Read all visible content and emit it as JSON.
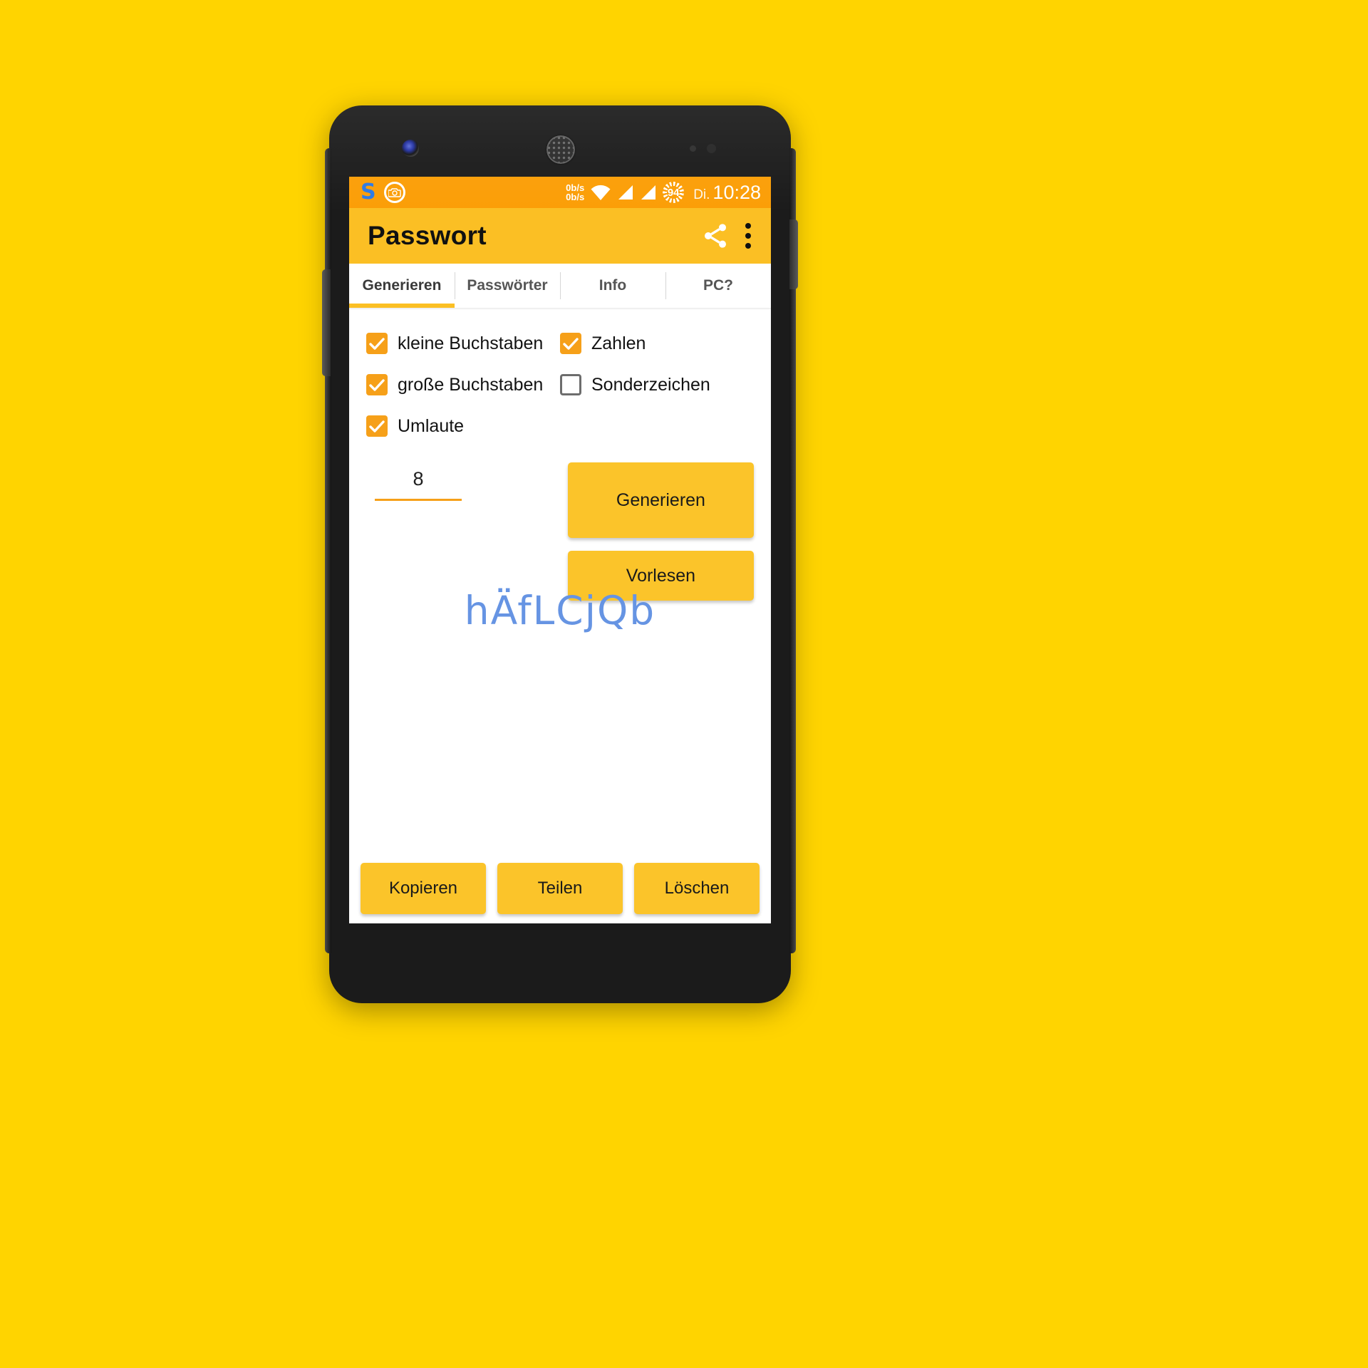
{
  "wallpaper": {
    "background_color": "#FFD400"
  },
  "device": {
    "name": "android-phone",
    "body_color": "#1b1b1b"
  },
  "statusbar": {
    "background_color": "#FB9E07",
    "notification_icons": [
      {
        "name": "s-app-icon",
        "glyph": "S"
      },
      {
        "name": "screenshot-camera-icon",
        "glyph": "camera"
      }
    ],
    "net_speed_up": "0b/s",
    "net_speed_down": "0b/s",
    "wifi_icon": "wifi-full-icon",
    "signal_icons": [
      "signal-bars-icon",
      "signal-bars-icon"
    ],
    "battery_percent": "94",
    "weekday": "Di.",
    "time": "10:28"
  },
  "appbar": {
    "background_color": "#FBBF24",
    "title": "Passwort",
    "share_icon": "share-icon",
    "overflow_icon": "overflow-menu-icon"
  },
  "tabs": {
    "active_index": 0,
    "indicator_color": "#FBBF24",
    "items": [
      {
        "label": "Generieren"
      },
      {
        "label": "Passwörter"
      },
      {
        "label": "Info"
      },
      {
        "label": "PC?"
      }
    ]
  },
  "options": {
    "rows": [
      [
        {
          "label": "kleine Buchstaben",
          "checked": true
        },
        {
          "label": "Zahlen",
          "checked": true
        }
      ],
      [
        {
          "label": "große Buchstaben",
          "checked": true
        },
        {
          "label": "Sonderzeichen",
          "checked": false
        }
      ],
      [
        {
          "label": "Umlaute",
          "checked": true
        }
      ]
    ],
    "checked_color": "#F6A019"
  },
  "length_field": {
    "value": "8",
    "placeholder": "8",
    "underline_color": "#F6A019"
  },
  "actions": {
    "generate_label": "Generieren",
    "read_aloud_label": "Vorlesen",
    "button_color": "#FBC42A"
  },
  "result": {
    "password": "hÄfLCjQb",
    "text_color": "#6694E3"
  },
  "bottom_actions": [
    {
      "label": "Kopieren"
    },
    {
      "label": "Teilen"
    },
    {
      "label": "Löschen"
    }
  ]
}
